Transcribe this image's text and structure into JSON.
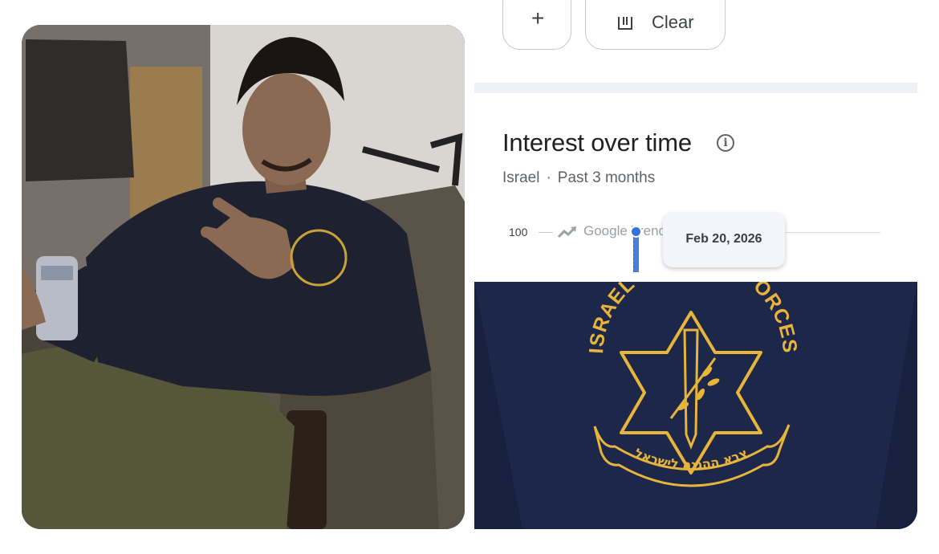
{
  "left_photo": {
    "description_icon": "photo-of-man-in-armchair"
  },
  "top_controls": {
    "add_button_label": "+",
    "clear_button_label": "Clear",
    "clear_icon": "trash-icon"
  },
  "interest_card": {
    "title": "Interest over time",
    "info_icon": "info-icon",
    "region": "Israel",
    "separator": "·",
    "period": "Past 3 months",
    "y_axis_max": "100",
    "watermark": "Google Trends",
    "tooltip_date": "Feb 20, 2026",
    "accent_color": "#3771e0"
  },
  "shirt_logo": {
    "arc_text": "ISRAEL DEFENSE FORCES",
    "banner_text": "צבא ההגנה לישראל",
    "text_color": "#e7b53a",
    "background_color": "#1c2749"
  }
}
